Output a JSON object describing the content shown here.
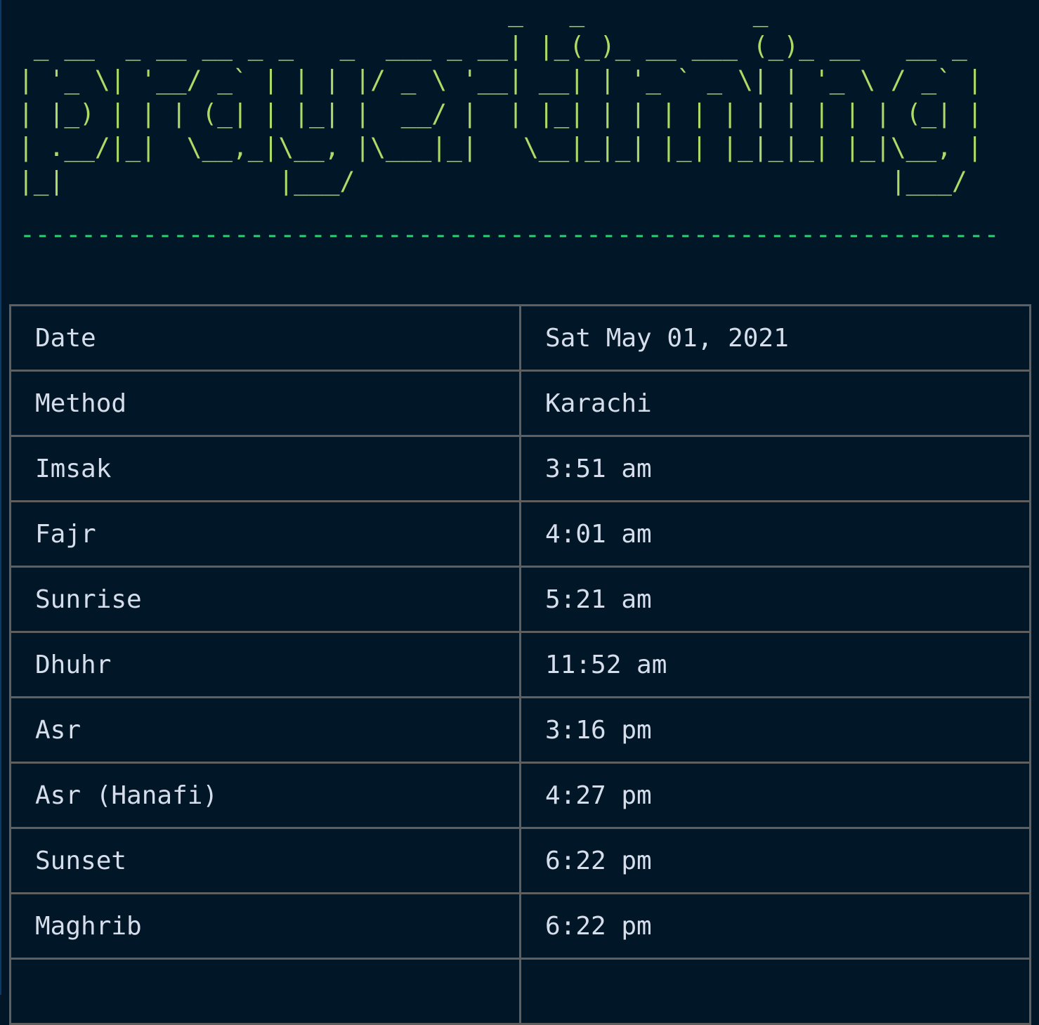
{
  "banner": {
    "ascii_art": "                                _   _           _             \n _ __  _ __ __ _ _   _  ___ _ __| |_(_)_ __ ___ (_)_ __   __ _ \n| '_ \\| '__/ _` | | | |/ _ \\ '__| __| | '_ ` _ \\| | '_ \\ / _` |\n| |_) | | | (_| | |_| |  __/ |  | |_| | | | | | | | | | | (_| |\n| .__/|_|  \\__,_|\\__, |\\___|_|   \\__|_|_| |_| |_|_|_| |_|\\__, |\n|_|              |___/                                   |___/ ",
    "text": "prayertiming",
    "color": "#addb67"
  },
  "divider": "----------------------------------------------------------------",
  "rows": [
    {
      "label": "Date",
      "value": "Sat May 01, 2021"
    },
    {
      "label": "Method",
      "value": "Karachi"
    },
    {
      "label": "Imsak",
      "value": "3:51 am"
    },
    {
      "label": "Fajr",
      "value": "4:01 am"
    },
    {
      "label": "Sunrise",
      "value": "5:21 am"
    },
    {
      "label": "Dhuhr",
      "value": "11:52 am"
    },
    {
      "label": "Asr",
      "value": "3:16 pm"
    },
    {
      "label": "Asr (Hanafi)",
      "value": "4:27 pm"
    },
    {
      "label": "Sunset",
      "value": "6:22 pm"
    },
    {
      "label": "Maghrib",
      "value": "6:22 pm"
    }
  ]
}
